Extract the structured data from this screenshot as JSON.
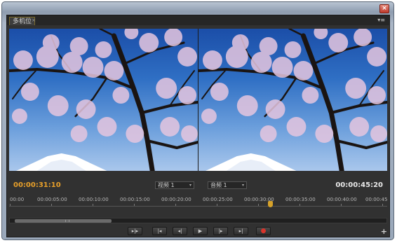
{
  "window": {
    "close_icon": "close-icon"
  },
  "panel": {
    "tab_label": "多机位",
    "tab_close": "×",
    "menu_icon": "▾≡"
  },
  "viewer": {
    "current_timecode": "00:00:31:10",
    "duration_timecode": "00:00:45:20",
    "video_track": {
      "label": "视频 1",
      "caret": "▾"
    },
    "audio_track": {
      "label": "音频 1",
      "caret": "▾"
    }
  },
  "ruler": {
    "ticks": [
      "00:00",
      "00:00:05:00",
      "00:00:10:00",
      "00:00:15:00",
      "00:00:20:00",
      "00:00:25:00",
      "00:00:30:00",
      "00:00:35:00",
      "00:00:40:00",
      "00:00:45"
    ],
    "playhead_time": "00:00:31:10"
  },
  "transport": {
    "buttons": [
      {
        "name": "play-in-to-out-button",
        "glyph": "▸|▸"
      },
      {
        "name": "go-to-in-point-button",
        "glyph": "|◂"
      },
      {
        "name": "step-back-button",
        "glyph": "◂|"
      },
      {
        "name": "play-button",
        "glyph": "▶"
      },
      {
        "name": "step-forward-button",
        "glyph": "|▸"
      },
      {
        "name": "go-to-out-point-button",
        "glyph": "▸|"
      },
      {
        "name": "record-button",
        "glyph": "●"
      }
    ],
    "add_glyph": "+"
  },
  "colors": {
    "current_timecode": "#e8a02a",
    "panel_bg": "#313131",
    "record": "#d9342b"
  }
}
